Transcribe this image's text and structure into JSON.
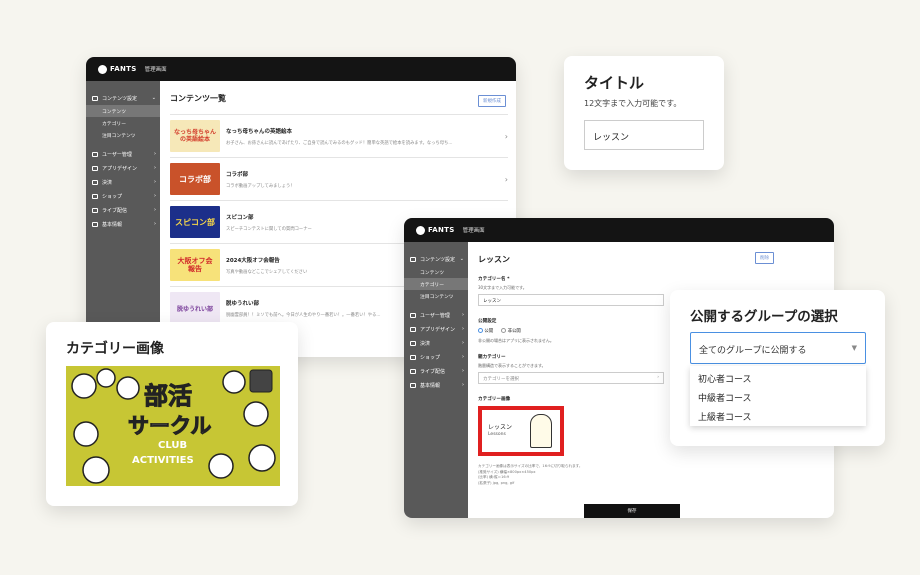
{
  "windowA": {
    "logo": "FANTS",
    "admin": "管理画面",
    "sidebar": {
      "section": "コンテンツ設定",
      "subs": [
        "コンテンツ",
        "カテゴリー",
        "注目コンテンツ"
      ],
      "items": [
        "ユーザー管理",
        "アプリデザイン",
        "決済",
        "ショップ",
        "ライブ配信",
        "基本情報"
      ]
    },
    "title": "コンテンツ一覧",
    "new_button": "新規作成",
    "rows": [
      {
        "title": "なっち母ちゃんの英語絵本",
        "desc": "お子さん、お孫さんに読んであげたり、ご自身で読んでみるのもグッド！簡単な英語で絵本を読みます。なっち母ち...",
        "thumb": "なっち母ちゃんの英語絵本"
      },
      {
        "title": "コラボ部",
        "desc": "コラボ動画アップしてみましょう！",
        "thumb": "コラボ部"
      },
      {
        "title": "スピコン部",
        "desc": "スピーチコンテストに関しての質問コーナー",
        "thumb": "スピコン部"
      },
      {
        "title": "2024大阪オフ会報告",
        "desc": "写真や動画などここでシェアしてください",
        "thumb": "大阪オフ会報告"
      },
      {
        "title": "脱ゆうれい部",
        "desc": "脱幽霊部員！！ミソでも前へ。今日が人生のやり一番若い！。一番若い！やる...",
        "thumb": "脱ゆうれい部"
      }
    ]
  },
  "windowB": {
    "logo": "FANTS",
    "admin": "管理画面",
    "sidebar": {
      "section": "コンテンツ設定",
      "subs": [
        "コンテンツ",
        "カテゴリー",
        "注目コンテンツ"
      ],
      "items": [
        "ユーザー管理",
        "アプリデザイン",
        "決済",
        "ショップ",
        "ライブ配信",
        "基本情報"
      ]
    },
    "title": "レッスン",
    "delete_button": "削除",
    "name_label": "カテゴリー名 *",
    "name_help": "30文字まで入力可能です。",
    "name_value": "レッスン",
    "publish_label": "公開設定",
    "publish_on": "公開",
    "publish_off": "非公開",
    "publish_help": "非公開の場合はアプリに表示されません。",
    "parent_label": "親カテゴリー",
    "parent_help": "階層構造で表示することができます。",
    "parent_placeholder": "カテゴリーを選択",
    "image_label": "カテゴリー画像",
    "image_text": "レッスン",
    "image_sub": "Lessons",
    "image_help": [
      "カテゴリー画像は表示サイズの比率で、16:9に切り取られます。",
      "(推奨サイズ) 横幅×800px×450px",
      "(比率) 横:縦＝16:9",
      "(拡張子) jpg, png, gif"
    ],
    "save": "保存"
  },
  "cardTitle": {
    "heading": "タイトル",
    "sub": "12文字まで入力可能です。",
    "value": "レッスン"
  },
  "cardCat": {
    "heading": "カテゴリー画像",
    "img_line1": "部活",
    "img_line2": "サークル",
    "img_line3": "CLUB",
    "img_line4": "ACTIVITIES"
  },
  "cardGroup": {
    "heading": "公開するグループの選択",
    "selected": "全てのグループに公開する",
    "options": [
      "初心者コース",
      "中級者コース",
      "上級者コース"
    ]
  },
  "colors": {
    "accent": "#4a90e2",
    "sidebar": "#595959",
    "topbar": "#141414",
    "category_bg": "#c7c634"
  }
}
